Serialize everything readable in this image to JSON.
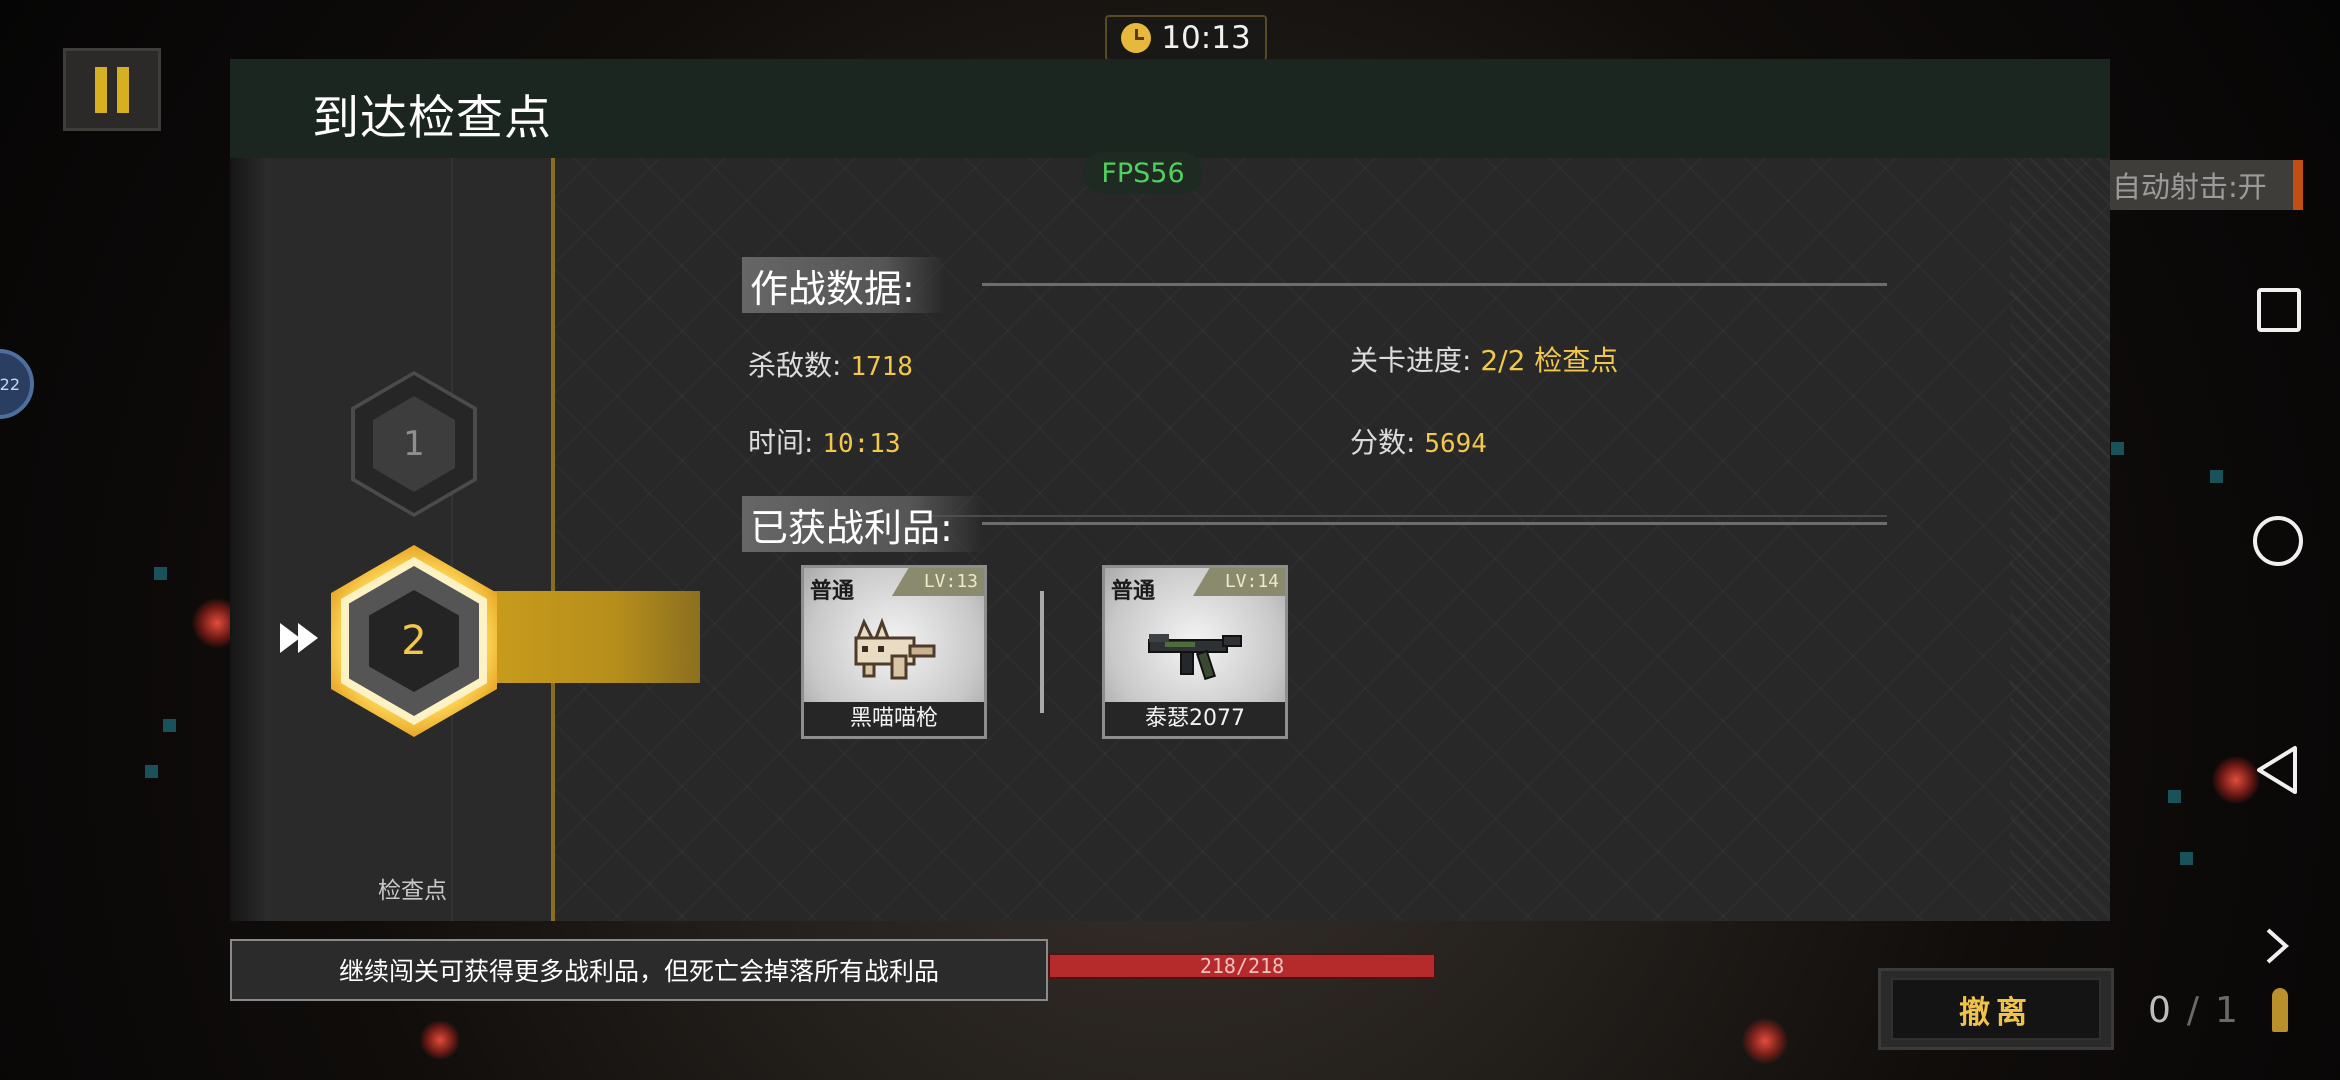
{
  "hud": {
    "timer": "10:13",
    "fps": "FPS56",
    "auto_shoot": "自动射击:开",
    "left_badge": "22"
  },
  "dialog": {
    "title": "到达检查点",
    "stats_heading": "作战数据:",
    "loot_heading": "已获战利品:",
    "stats": {
      "kills_label": "杀敌数:",
      "kills_value": "1718",
      "progress_label": "关卡进度:",
      "progress_value": "2/2 检查点",
      "time_label": "时间:",
      "time_value": "10:13",
      "score_label": "分数:",
      "score_value": "5694"
    },
    "checkpoints": {
      "items": [
        "1",
        "2"
      ],
      "current": "2",
      "label": "检查点"
    },
    "loot": [
      {
        "rarity": "普通",
        "level": "LV:13",
        "name": "黑喵喵枪",
        "icon": "cat-gun-icon"
      },
      {
        "rarity": "普通",
        "level": "LV:14",
        "name": "泰瑟2077",
        "icon": "taser-rifle-icon"
      }
    ]
  },
  "bottom": {
    "tip": "继续闯关可获得更多战利品，但死亡会掉落所有战利品",
    "hp": "218/218",
    "hp_fraction": 1.0,
    "evacuate": "撤离",
    "ammo_current": "0",
    "ammo_sep": "/",
    "ammo_max": "1"
  },
  "colors": {
    "accent_gold": "#f1c84c",
    "fps_green": "#4fd160",
    "hp_red": "#a82424"
  }
}
